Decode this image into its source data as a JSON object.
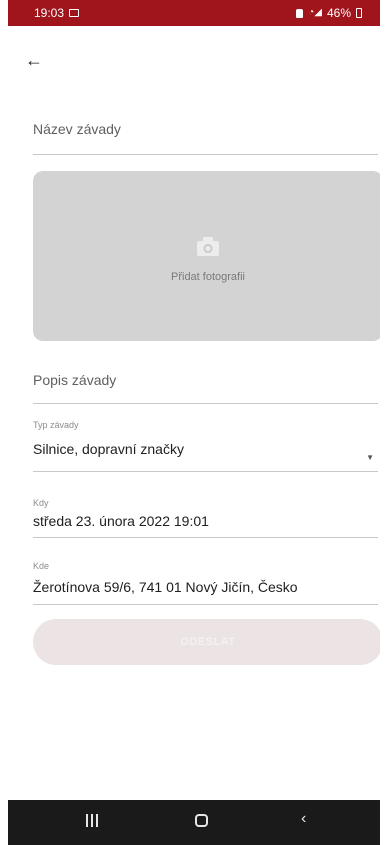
{
  "status_bar": {
    "time": "19:03",
    "battery": "46%"
  },
  "form": {
    "name_placeholder": "Název závady",
    "photo_label": "Přidat fotografii",
    "description_placeholder": "Popis závady",
    "type_label": "Typ závady",
    "type_value": "Silnice, dopravní značky",
    "when_label": "Kdy",
    "when_value": "středa 23. února 2022 19:01",
    "where_label": "Kde",
    "where_value": "Žerotínova 59/6, 741 01 Nový Jičín, Česko",
    "submit_label": "ODESLAT"
  },
  "colors": {
    "status_bar": "#a0141c",
    "photo_area": "#d3d3d3",
    "submit_button": "#ece4e4",
    "nav_bar": "#1a1a1a"
  }
}
